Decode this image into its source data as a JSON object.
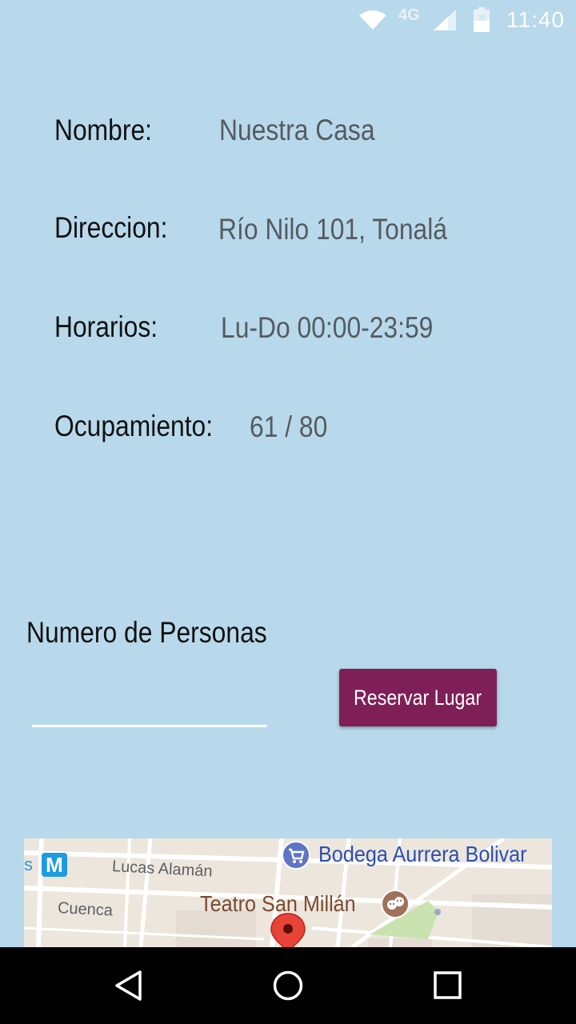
{
  "status_bar": {
    "time": "11:40",
    "network": "4G",
    "battery_level": "35",
    "icons": [
      "wifi-icon",
      "signal-icon",
      "battery-icon"
    ]
  },
  "details": {
    "name_label": "Nombre:",
    "name_value": "Nuestra Casa",
    "address_label": "Direccion:",
    "address_value": "Río Nilo 101, Tonalá",
    "hours_label": "Horarios:",
    "hours_value": "Lu-Do 00:00-23:59",
    "occupancy_label": "Ocupamiento:",
    "occupancy_value": "61 / 80"
  },
  "reservation": {
    "persons_label": "Numero de Personas",
    "persons_value": "",
    "reserve_button": "Reservar Lugar"
  },
  "map": {
    "metro_letter": "M",
    "metro_label": "s",
    "street_lucas": "Lucas Alamán",
    "street_cuenca": "Cuenca",
    "poi_store": "Bodega Aurrera Bolivar",
    "poi_theater": "Teatro San Millán"
  },
  "colors": {
    "background": "#B8D9EB",
    "button": "#7E1F57",
    "value_text": "#555b60",
    "poi_blue": "#2D4FB0",
    "poi_brown": "#7A4A2E"
  },
  "nav_bar": {
    "icons": [
      "back-icon",
      "home-icon",
      "recents-icon"
    ]
  }
}
